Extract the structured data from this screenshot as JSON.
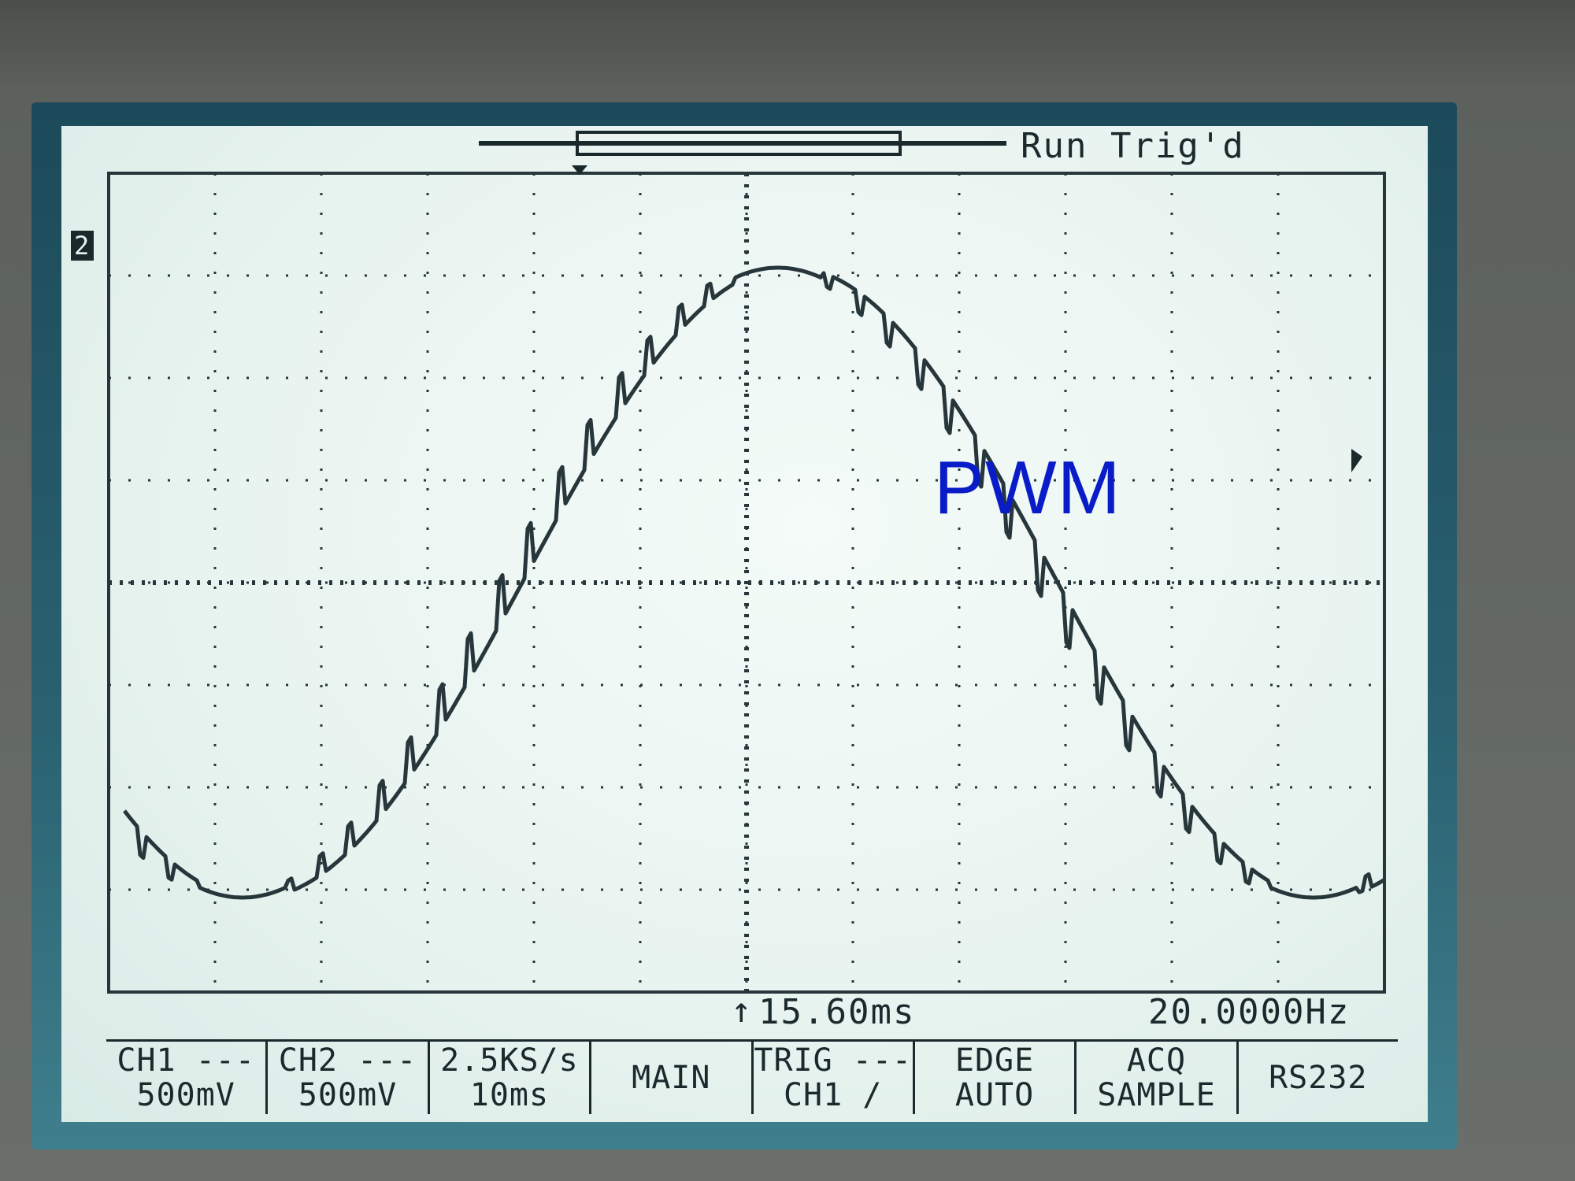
{
  "status": {
    "acq_state": "Run Trig'd",
    "trigger_time": "15.60ms",
    "frequency": "20.0000Hz"
  },
  "overlay_label": "PWM",
  "channel_marker": "2",
  "menu": [
    {
      "line1": "CH1 ---",
      "line2": "500mV"
    },
    {
      "line1": "CH2 ---",
      "line2": "500mV"
    },
    {
      "line1": "2.5KS/s",
      "line2": "10ms"
    },
    {
      "line1": "MAIN",
      "line2": ""
    },
    {
      "line1": "TRIG ---",
      "line2": "CH1 /"
    },
    {
      "line1": "EDGE",
      "line2": "AUTO"
    },
    {
      "line1": "ACQ",
      "line2": "SAMPLE"
    },
    {
      "line1": "RS232",
      "line2": ""
    }
  ],
  "trace_color": "#27363a",
  "label_color": "#0a1cc8"
}
